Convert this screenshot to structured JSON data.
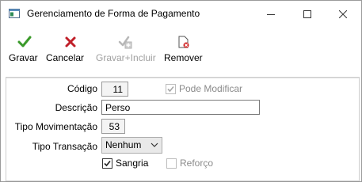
{
  "window": {
    "title": "Gerenciamento de Forma de Pagamento"
  },
  "toolbar": {
    "gravar": {
      "label": "Gravar",
      "icon": "checkmark-icon",
      "color": "#3a9a2a"
    },
    "cancelar": {
      "label": "Cancelar",
      "icon": "x-icon",
      "color": "#c0202a"
    },
    "gravar_incluir": {
      "label": "Gravar+Incluir",
      "icon": "save-add-icon",
      "disabled": true
    },
    "remover": {
      "label": "Remover",
      "icon": "remove-icon"
    }
  },
  "form": {
    "codigo": {
      "label": "Código",
      "value": "11"
    },
    "pode_modificar": {
      "label": "Pode Modificar",
      "checked": true,
      "disabled": true
    },
    "descricao": {
      "label": "Descrição",
      "value": "Perso"
    },
    "tipo_movimentacao": {
      "label": "Tipo Movimentação",
      "value": "53"
    },
    "tipo_transacao": {
      "label": "Tipo Transação",
      "value": "Nenhum"
    },
    "sangria": {
      "label": "Sangria",
      "checked": true
    },
    "reforco": {
      "label": "Reforço",
      "checked": false,
      "disabled": true
    }
  }
}
